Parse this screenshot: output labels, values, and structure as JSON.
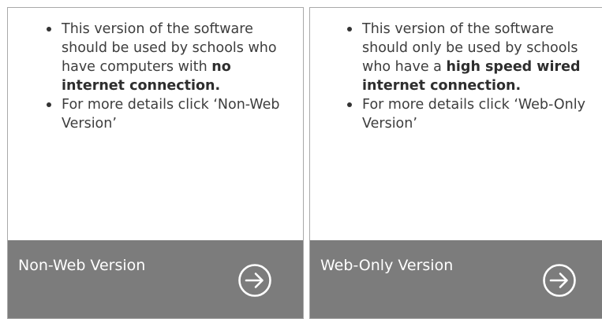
{
  "cards": [
    {
      "bullets": [
        {
          "before": "This version of the software should be used by schools who have computers with ",
          "bold": "no internet connection.",
          "after": ""
        },
        {
          "before": "For more details click ‘Non-Web Version’",
          "bold": "",
          "after": ""
        }
      ],
      "footer_label": "Non-Web Version",
      "footer_icon": "arrow-right-circle-icon"
    },
    {
      "bullets": [
        {
          "before": "This version of the software should only be used by schools who have a ",
          "bold": "high speed wired internet connection.",
          "after": ""
        },
        {
          "before": "For more details click ‘Web-Only Version’",
          "bold": "",
          "after": ""
        }
      ],
      "footer_label": "Web-Only Version",
      "footer_icon": "arrow-right-circle-icon"
    }
  ],
  "colors": {
    "footer_bg": "#7c7c7c",
    "footer_text": "#ffffff",
    "body_text": "#3d3d3d",
    "border": "#a9a9a9"
  }
}
